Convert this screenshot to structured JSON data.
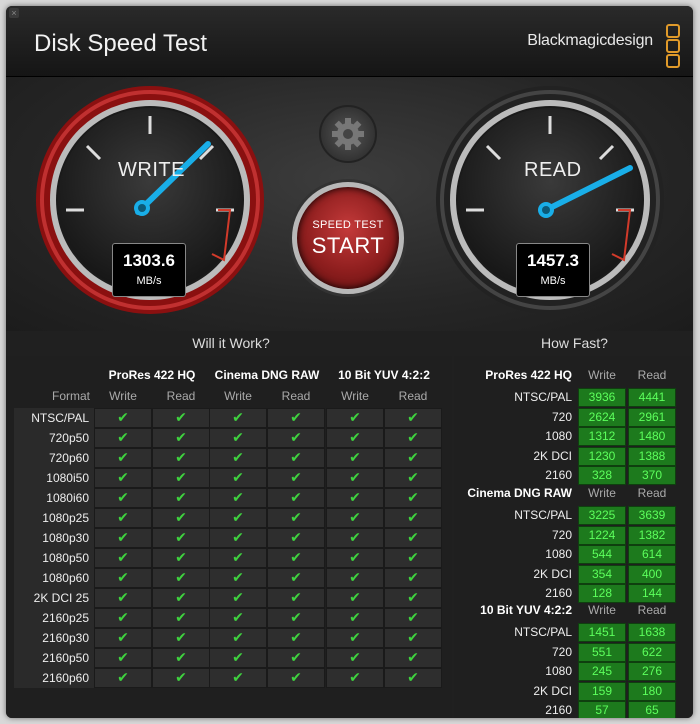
{
  "window": {
    "title": "Disk Speed Test",
    "brand": "Blackmagicdesign"
  },
  "gauges": {
    "write": {
      "label": "WRITE",
      "value": "1303.6",
      "unit": "MB/s"
    },
    "read": {
      "label": "READ",
      "value": "1457.3",
      "unit": "MB/s"
    }
  },
  "start_button": {
    "line1": "SPEED TEST",
    "line2": "START"
  },
  "will_it_work": {
    "title": "Will it Work?",
    "format_label": "Format",
    "groups": [
      {
        "name": "ProRes 422 HQ",
        "write": "Write",
        "read": "Read"
      },
      {
        "name": "Cinema DNG RAW",
        "write": "Write",
        "read": "Read"
      },
      {
        "name": "10 Bit YUV 4:2:2",
        "write": "Write",
        "read": "Read"
      }
    ],
    "formats": [
      "NTSC/PAL",
      "720p50",
      "720p60",
      "1080i50",
      "1080i60",
      "1080p25",
      "1080p30",
      "1080p50",
      "1080p60",
      "2K DCI 25",
      "2160p25",
      "2160p30",
      "2160p50",
      "2160p60"
    ],
    "check_icon": "✔"
  },
  "how_fast": {
    "title": "How Fast?",
    "groups": [
      {
        "name": "ProRes 422 HQ",
        "write": "Write",
        "read": "Read",
        "rows": [
          {
            "label": "NTSC/PAL",
            "write": "3936",
            "read": "4441"
          },
          {
            "label": "720",
            "write": "2624",
            "read": "2961"
          },
          {
            "label": "1080",
            "write": "1312",
            "read": "1480"
          },
          {
            "label": "2K DCI",
            "write": "1230",
            "read": "1388"
          },
          {
            "label": "2160",
            "write": "328",
            "read": "370"
          }
        ]
      },
      {
        "name": "Cinema DNG RAW",
        "write": "Write",
        "read": "Read",
        "rows": [
          {
            "label": "NTSC/PAL",
            "write": "3225",
            "read": "3639"
          },
          {
            "label": "720",
            "write": "1224",
            "read": "1382"
          },
          {
            "label": "1080",
            "write": "544",
            "read": "614"
          },
          {
            "label": "2K DCI",
            "write": "354",
            "read": "400"
          },
          {
            "label": "2160",
            "write": "128",
            "read": "144"
          }
        ]
      },
      {
        "name": "10 Bit YUV 4:2:2",
        "write": "Write",
        "read": "Read",
        "rows": [
          {
            "label": "NTSC/PAL",
            "write": "1451",
            "read": "1638"
          },
          {
            "label": "720",
            "write": "551",
            "read": "622"
          },
          {
            "label": "1080",
            "write": "245",
            "read": "276"
          },
          {
            "label": "2K DCI",
            "write": "159",
            "read": "180"
          },
          {
            "label": "2160",
            "write": "57",
            "read": "65"
          }
        ]
      }
    ]
  }
}
